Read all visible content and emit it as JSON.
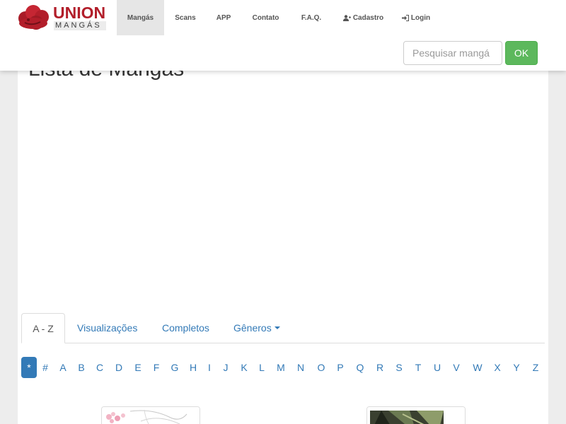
{
  "brand": {
    "name_top": "UNION",
    "name_bottom": "MANGÁS"
  },
  "nav": {
    "items": [
      {
        "label": "Mangás",
        "icon": "",
        "active": true
      },
      {
        "label": "Scans",
        "icon": "",
        "active": false
      },
      {
        "label": "APP",
        "icon": "",
        "active": false
      },
      {
        "label": "Contato",
        "icon": "",
        "active": false
      },
      {
        "label": "F.A.Q.",
        "icon": "",
        "active": false
      },
      {
        "label": "Cadastro",
        "icon": "user-plus-icon",
        "active": false
      },
      {
        "label": "Login",
        "icon": "sign-in-icon",
        "active": false
      }
    ]
  },
  "search": {
    "placeholder": "Pesquisar mangá",
    "button_label": "OK"
  },
  "page": {
    "title": "Lista de Mangás"
  },
  "tabs": [
    {
      "label": "A - Z",
      "active": true
    },
    {
      "label": "Visualizações",
      "active": false
    },
    {
      "label": "Completos",
      "active": false
    },
    {
      "label": "Gêneros",
      "active": false,
      "dropdown": true
    }
  ],
  "letters": {
    "items": [
      "*",
      "#",
      "A",
      "B",
      "C",
      "D",
      "E",
      "F",
      "G",
      "H",
      "I",
      "J",
      "K",
      "L",
      "M",
      "N",
      "O",
      "P",
      "Q",
      "R",
      "S",
      "T",
      "U",
      "V",
      "W",
      "X",
      "Y",
      "Z"
    ],
    "active": "*"
  },
  "colors": {
    "brand_red": "#b21e2a",
    "link_blue": "#337ab7",
    "ok_green": "#5cb85c"
  }
}
